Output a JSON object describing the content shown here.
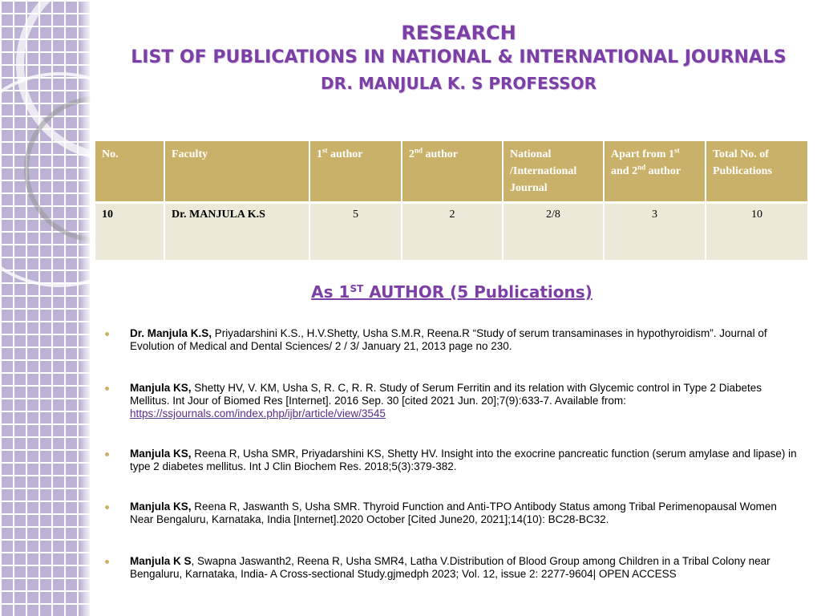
{
  "title": {
    "line1": "RESEARCH",
    "line2": "LIST OF PUBLICATIONS IN NATIONAL & INTERNATIONAL JOURNALS",
    "line3": "DR. MANJULA K. S PROFESSOR"
  },
  "table": {
    "headers": {
      "no": "No.",
      "faculty": "Faculty",
      "first_author_num": "1",
      "first_author_sup": "st",
      "first_author_label": " author",
      "second_author_num": "2",
      "second_author_sup": "nd",
      "second_author_label": " author",
      "national_international": "National /International Journal",
      "apart_pre": "Apart from 1",
      "apart_sup1": "st",
      "apart_mid": " and 2",
      "apart_sup2": "nd",
      "apart_post": " author",
      "total": "Total No. of Publications"
    },
    "row": {
      "no": "10",
      "faculty": "Dr. MANJULA K.S",
      "first_author": "5",
      "second_author": "2",
      "national_international": "2/8",
      "apart": "3",
      "total": "10"
    }
  },
  "section": {
    "pre": "As 1",
    "sup": "ST",
    "post": " AUTHOR (5 Publications)"
  },
  "publications": [
    {
      "author": "Dr. Manjula K.S,",
      "text": " Priyadarshini K.S., H.V.Shetty, Usha S.M.R, Reena.R  “Study of serum transaminases in hypothyroidism”. Journal of Evolution of Medical and Dental Sciences/ 2 / 3/ January 21, 2013 page no 230."
    },
    {
      "author": "Manjula KS,",
      "text": " Shetty HV, V. KM, Usha S, R. C, R. R. Study of Serum Ferritin and its relation with Glycemic control in Type 2 Diabetes Mellitus. Int Jour of Biomed Res [Internet]. 2016 Sep. 30 [cited 2021 Jun. 20];7(9):633-7. Available from: ",
      "link": "https://ssjournals.com/index.php/ijbr/article/view/3545"
    },
    {
      "author": "Manjula KS,",
      "text": " Reena R, Usha SMR, Priyadarshini KS, Shetty HV. Insight into the exocrine pancreatic function (serum amylase and lipase) in type 2 diabetes mellitus. Int J Clin Biochem Res. 2018;5(3):379-382."
    },
    {
      "author": " Manjula KS,",
      "text": " Reena R, Jaswanth S, Usha SMR. Thyroid Function and Anti-TPO Antibody Status among Tribal Perimenopausal Women Near Bengaluru, Karnataka, India [Internet].2020 October [Cited June20, 2021];14(10): BC28-BC32."
    },
    {
      "author": "Manjula K S",
      "text": ", Swapna Jaswanth2, Reena R, Usha SMR4, Latha V.Distribution of Blood Group among Children in a Tribal Colony near Bengaluru, Karnataka, India- A Cross-sectional Study.gjmedph 2023; Vol. 12, issue 2: 2277-9604| OPEN ACCESS"
    }
  ],
  "colors": {
    "title": "#7b3fa6",
    "table_header": "#c9b16a",
    "table_row": "#ede9d8",
    "strip": "#bdb2d3"
  }
}
